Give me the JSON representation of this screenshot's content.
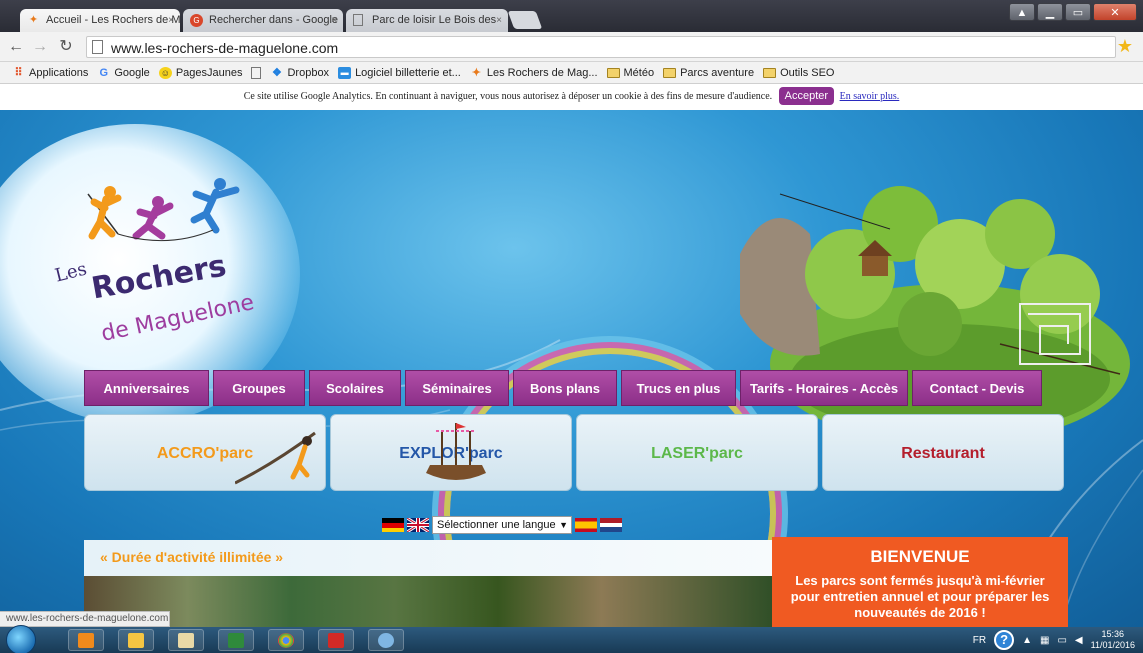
{
  "browser": {
    "tabs": [
      {
        "title": "Accueil - Les Rochers de M",
        "icon": "climber-favicon-icon"
      },
      {
        "title": "Rechercher dans - Google",
        "icon": "google-favicon-icon"
      },
      {
        "title": "Parc de loisir Le Bois des",
        "icon": "page-favicon-icon"
      }
    ],
    "tab_close": "×",
    "url": "www.les-rochers-de-maguelone.com",
    "bookmarks": [
      {
        "label": "Applications",
        "icon": "apps-grid-icon"
      },
      {
        "label": "Google",
        "icon": "google-icon"
      },
      {
        "label": "PagesJaunes",
        "icon": "pagesjaunes-icon"
      },
      {
        "label": "",
        "icon": "page-icon"
      },
      {
        "label": "Dropbox",
        "icon": "dropbox-icon"
      },
      {
        "label": "Logiciel billetterie et...",
        "icon": "ticket-icon"
      },
      {
        "label": "Les Rochers de Mag...",
        "icon": "climber-icon"
      },
      {
        "label": "Météo",
        "icon": "folder-icon"
      },
      {
        "label": "Parcs aventure",
        "icon": "folder-icon"
      },
      {
        "label": "Outils SEO",
        "icon": "folder-icon"
      }
    ],
    "status_url": "www.les-rochers-de-maguelone.com"
  },
  "page": {
    "cookie": {
      "text": "Ce site utilise Google Analytics. En continuant à naviguer, vous nous autorisez à déposer un cookie à des fins de mesure d'audience.",
      "accept_label": "Accepter",
      "more_label": "En savoir plus."
    },
    "logo": {
      "les": "Les",
      "rochers": "Rochers",
      "de_maguelone": "de Maguelone"
    },
    "menu": [
      {
        "label": "Anniversaires",
        "width": 125
      },
      {
        "label": "Groupes",
        "width": 92
      },
      {
        "label": "Scolaires",
        "width": 92
      },
      {
        "label": "Séminaires",
        "width": 104
      },
      {
        "label": "Bons plans",
        "width": 104
      },
      {
        "label": "Trucs en plus",
        "width": 115
      },
      {
        "label": "Tarifs - Horaires - Accès",
        "width": 168
      },
      {
        "label": "Contact - Devis",
        "width": 130
      }
    ],
    "panels": {
      "accro": "ACCRO'parc",
      "explor": "EXPLOR'parc",
      "laser": "LASER'parc",
      "restaurant": "Restaurant"
    },
    "language_select": {
      "value": "Sélectionner une langue",
      "arrow": "▼"
    },
    "activity_banner": "« Durée d'activité illimitée »",
    "welcome": {
      "title": "BIENVENUE",
      "body": "Les parcs sont fermés jusqu'à mi-février pour entretien annuel et pour préparer les nouveautés de 2016 !"
    }
  },
  "taskbar": {
    "language": "FR",
    "help": "?",
    "time": "15:36",
    "date": "11/01/2016"
  },
  "colors": {
    "menu": "#9b3c96",
    "welcome": "#f05a22",
    "accro": "#f39a1b",
    "explor": "#2457a8",
    "laser": "#5cb84a",
    "restaurant": "#b41e2c"
  }
}
